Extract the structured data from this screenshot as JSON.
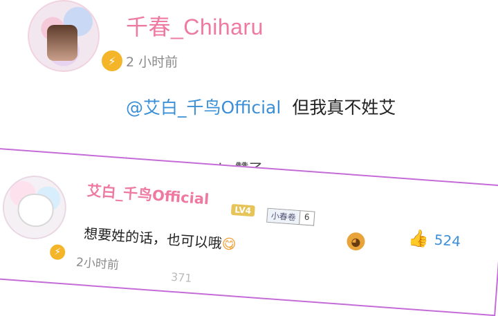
{
  "main_comment": {
    "username": "千春_Chiharu",
    "time": "2 小时前",
    "mention": "@艾白_千鸟Official",
    "text": "但我真不姓艾",
    "badge_icon": "⚡",
    "liked_by": "毯亚Maria 赞了"
  },
  "reply": {
    "username": "艾白_千鸟Official",
    "level": "LV4",
    "fan_badge_name": "小春卷",
    "fan_badge_level": "6",
    "text": "想要姓的话，也可以哦",
    "emoji": "😋",
    "time": "2小时前",
    "like_count": "524",
    "badge_icon": "⚡",
    "footer_partial": "371"
  },
  "colors": {
    "username": "#ef7aa1",
    "mention": "#3a8fd6",
    "highlight_border": "#c46bd8",
    "like_blue": "#3d8fd8"
  }
}
